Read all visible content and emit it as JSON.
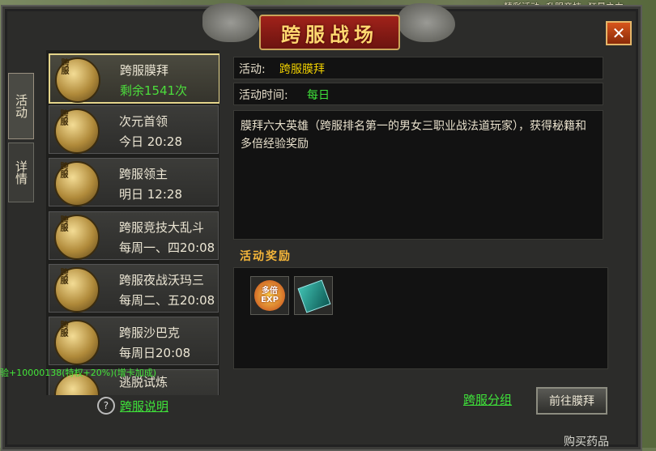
{
  "top_menu": [
    "精彩活动",
    "升服竞技",
    "狂暴之力"
  ],
  "title": "跨服战场",
  "close_label": "✕",
  "side_tabs": [
    {
      "label": "活动"
    },
    {
      "label": "详情"
    }
  ],
  "activities": [
    {
      "tag": "跨服",
      "name": "跨服膜拜",
      "time": "剩余1541次"
    },
    {
      "tag": "跨服",
      "name": "次元首领",
      "time": "今日 20:28"
    },
    {
      "tag": "跨服",
      "name": "跨服领主",
      "time": "明日 12:28"
    },
    {
      "tag": "跨服",
      "name": "跨服竞技大乱斗",
      "time": "每周一、四20:08"
    },
    {
      "tag": "跨服",
      "name": "跨服夜战沃玛三",
      "time": "每周二、五20:08"
    },
    {
      "tag": "跨服",
      "name": "跨服沙巴克",
      "time": "每周日20:08"
    },
    {
      "tag": "跨服",
      "name": "逃脱试炼",
      "time": ""
    }
  ],
  "help": {
    "icon": "?",
    "label": "跨服说明"
  },
  "detail": {
    "activity_label": "活动:",
    "activity_value": "跨服膜拜",
    "time_label": "活动时间:",
    "time_value": "每日",
    "description": "膜拜六大英雄（跨服排名第一的男女三职业战法道玩家），获得秘籍和多倍经验奖励",
    "reward_title": "活动奖励",
    "rewards": [
      {
        "icon": "multi-exp-icon",
        "text_top": "多倍",
        "text_bottom": "EXP"
      },
      {
        "icon": "skill-book-icon"
      }
    ]
  },
  "group_link": "跨服分组",
  "go_button": "前往膜拜",
  "bottom_status": "验+10000138(特权+20%)(增卡加成)",
  "buy_text": "购买药品",
  "colors": {
    "accent_green": "#3fe43a",
    "title_gold": "#ffd870",
    "value_yellow": "#f0d000",
    "highlight_border": "#e4d48a"
  }
}
